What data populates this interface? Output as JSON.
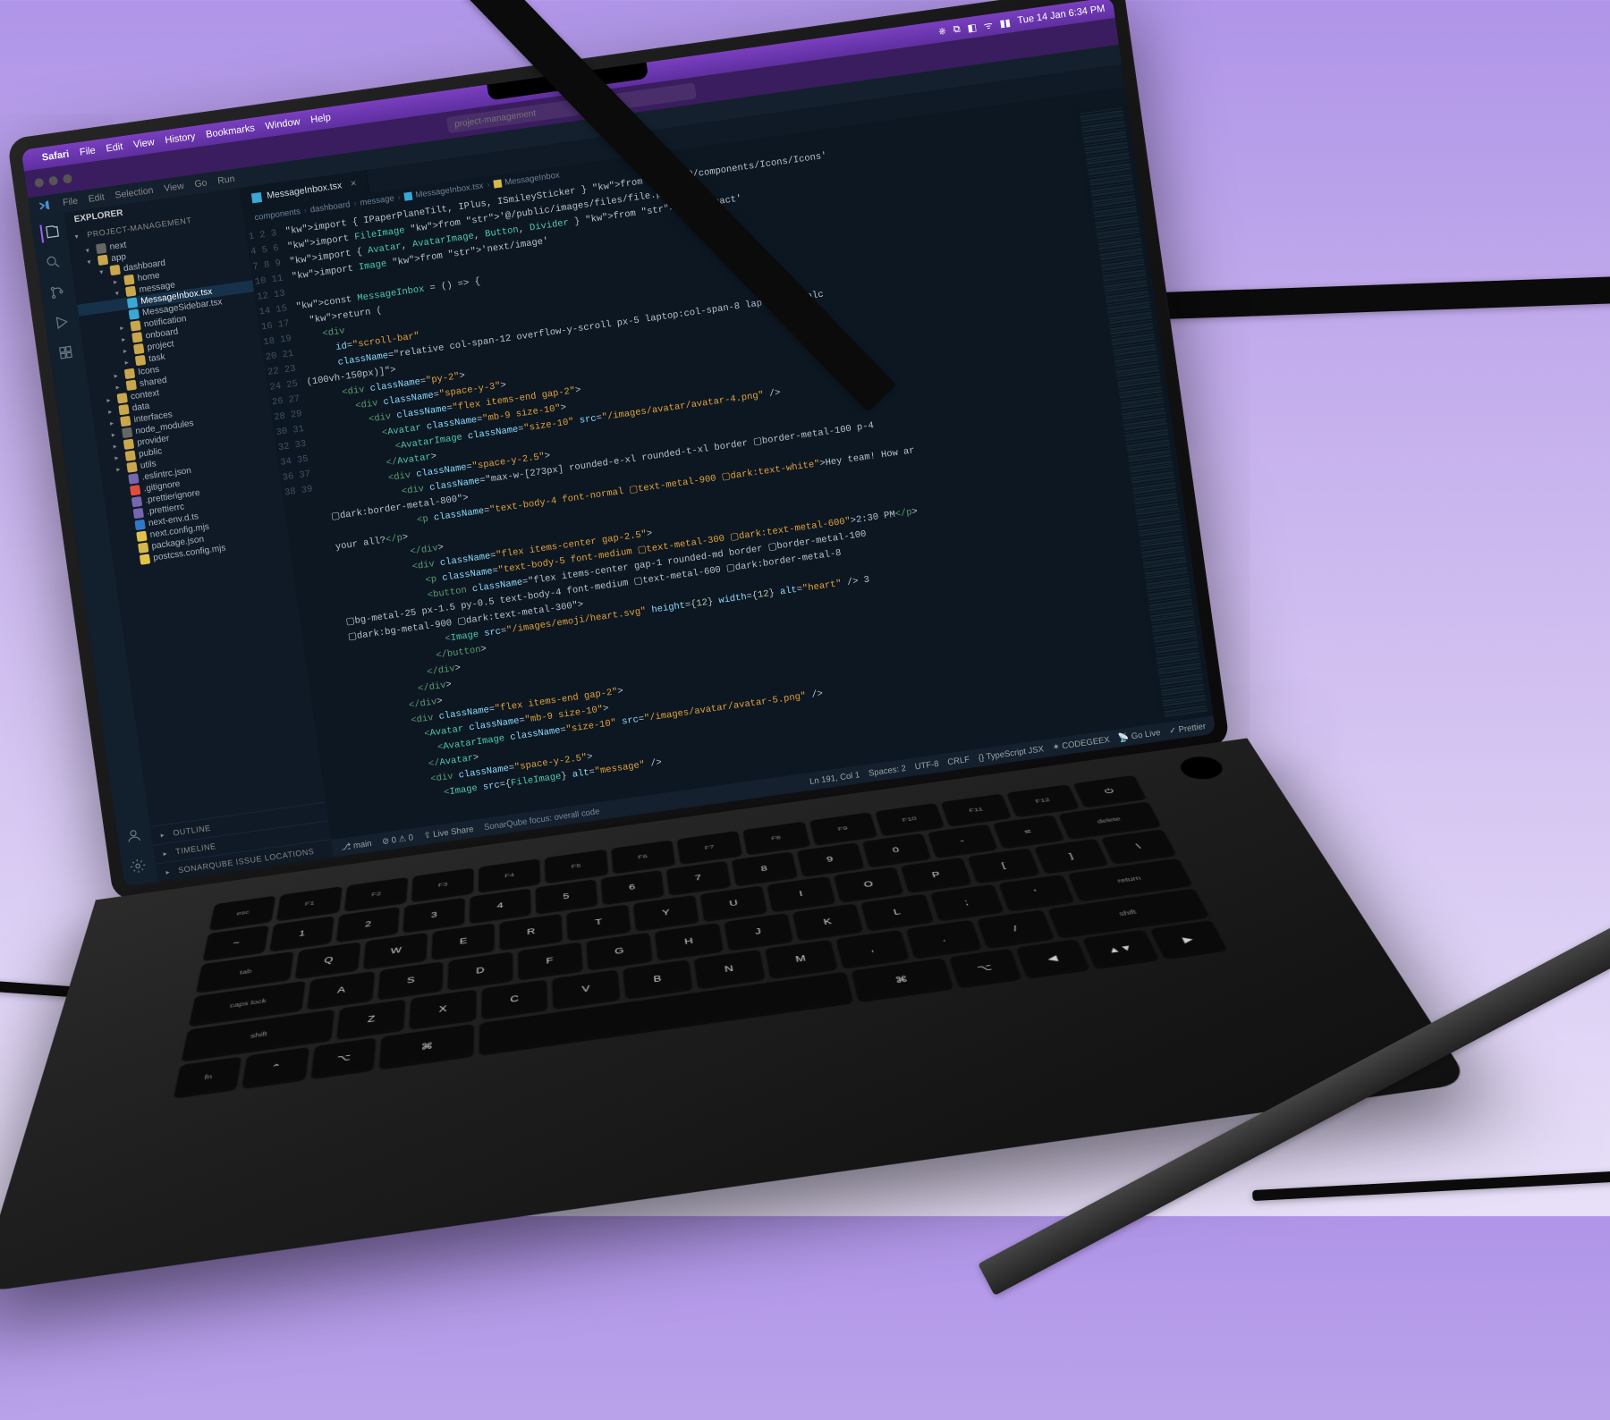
{
  "mac_menubar": {
    "app": "Safari",
    "items": [
      "File",
      "Edit",
      "View",
      "History",
      "Bookmarks",
      "Window",
      "Help"
    ],
    "datetime": "Tue 14 Jan  6:34 PM"
  },
  "vscode": {
    "title_search_placeholder": "project-management",
    "app_menu": [
      "File",
      "Edit",
      "Selection",
      "View",
      "Go",
      "Run"
    ],
    "explorer_label": "EXPLORER",
    "project_name": "PROJECT-MANAGEMENT",
    "outline_label": "OUTLINE",
    "timeline_label": "TIMELINE",
    "sonar_label": "SONARQUBE ISSUE LOCATIONS",
    "tab": {
      "name": "MessageInbox.tsx"
    },
    "breadcrumbs": [
      "components",
      "dashboard",
      "message",
      "MessageInbox.tsx",
      "MessageInbox"
    ],
    "statusbar": {
      "branch": "main",
      "errors": "0",
      "warnings": "0",
      "liveshare": "Live Share",
      "sonar_hint": "SonarQube focus: overall code",
      "cursor": "Ln 191, Col 1",
      "spaces": "Spaces: 2",
      "encoding": "UTF-8",
      "eol": "CRLF",
      "lang": "TypeScript JSX",
      "codegeex": "CODEGEEX",
      "golive": "Go Live",
      "prettier": "Prettier"
    }
  },
  "tree": [
    {
      "depth": 0,
      "kind": "folder",
      "open": true,
      "name": "next",
      "fi": "gray"
    },
    {
      "depth": 0,
      "kind": "folder",
      "open": true,
      "name": "app",
      "fi": "folder"
    },
    {
      "depth": 1,
      "kind": "folder",
      "open": true,
      "name": "dashboard",
      "fi": "folder"
    },
    {
      "depth": 2,
      "kind": "folder",
      "name": "home",
      "fi": "folder"
    },
    {
      "depth": 2,
      "kind": "folder",
      "open": true,
      "name": "message",
      "fi": "folder"
    },
    {
      "depth": 2,
      "kind": "file",
      "name": "MessageInbox.tsx",
      "fi": "react",
      "selected": true
    },
    {
      "depth": 2,
      "kind": "file",
      "name": "MessageSidebar.tsx",
      "fi": "react"
    },
    {
      "depth": 2,
      "kind": "folder",
      "name": "notification",
      "fi": "folder"
    },
    {
      "depth": 2,
      "kind": "folder",
      "name": "onboard",
      "fi": "folder"
    },
    {
      "depth": 2,
      "kind": "folder",
      "name": "project",
      "fi": "folder"
    },
    {
      "depth": 2,
      "kind": "folder",
      "name": "task",
      "fi": "folder"
    },
    {
      "depth": 1,
      "kind": "folder",
      "name": "Icons",
      "fi": "folder"
    },
    {
      "depth": 1,
      "kind": "folder",
      "name": "shared",
      "fi": "folder"
    },
    {
      "depth": 0,
      "kind": "folder",
      "name": "context",
      "fi": "folder"
    },
    {
      "depth": 0,
      "kind": "folder",
      "name": "data",
      "fi": "folder"
    },
    {
      "depth": 0,
      "kind": "folder",
      "name": "interfaces",
      "fi": "folder"
    },
    {
      "depth": 0,
      "kind": "folder",
      "name": "node_modules",
      "fi": "gray"
    },
    {
      "depth": 0,
      "kind": "folder",
      "name": "provider",
      "fi": "folder"
    },
    {
      "depth": 0,
      "kind": "folder",
      "name": "public",
      "fi": "folder"
    },
    {
      "depth": 0,
      "kind": "folder",
      "name": "utils",
      "fi": "folder"
    },
    {
      "depth": 0,
      "kind": "file",
      "name": ".eslintrc.json",
      "fi": "conf"
    },
    {
      "depth": 0,
      "kind": "file",
      "name": ".gitignore",
      "fi": "git"
    },
    {
      "depth": 0,
      "kind": "file",
      "name": ".prettierignore",
      "fi": "conf"
    },
    {
      "depth": 0,
      "kind": "file",
      "name": ".prettierrc",
      "fi": "conf"
    },
    {
      "depth": 0,
      "kind": "file",
      "name": "next-env.d.ts",
      "fi": "ts"
    },
    {
      "depth": 0,
      "kind": "file",
      "name": "next.config.mjs",
      "fi": "mjs"
    },
    {
      "depth": 0,
      "kind": "file",
      "name": "package.json",
      "fi": "json"
    },
    {
      "depth": 0,
      "kind": "file",
      "name": "postcss.config.mjs",
      "fi": "mjs"
    }
  ],
  "code_lines": [
    "import { IPaperPlaneTilt, IPlus, ISmileySticker } from '@/components/Icons/Icons'",
    "import FileImage from '@/public/images/files/file.png'",
    "import { Avatar, AvatarImage, Button, Divider } from 'keep-react'",
    "import Image from 'next/image'",
    "",
    "const MessageInbox = () => {",
    "  return (",
    "    <div",
    "      id=\"scroll-bar\"",
    "      className=\"relative col-span-12 overflow-y-scroll px-5 laptop:col-span-8 laptop:h-[calc",
    "(100vh-150px)]\">",
    "      <div className=\"py-2\">",
    "        <div className=\"space-y-3\">",
    "          <div className=\"flex items-end gap-2\">",
    "            <Avatar className=\"mb-9 size-10\">",
    "              <AvatarImage className=\"size-10\" src=\"/images/avatar/avatar-4.png\" />",
    "            </Avatar>",
    "            <div className=\"space-y-2.5\">",
    "              <div className=\"max-w-[273px] rounded-e-xl rounded-t-xl border ▢border-metal-100 p-4",
    " ▢dark:border-metal-800\">",
    "                <p className=\"text-body-4 font-normal ▢text-metal-900 ▢dark:text-white\">Hey team! How ar",
    " your all?</p>",
    "              </div>",
    "              <div className=\"flex items-center gap-2.5\">",
    "                <p className=\"text-body-5 font-medium ▢text-metal-300 ▢dark:text-metal-600\">2:30 PM</p>",
    "                <button className=\"flex items-center gap-1 rounded-md border ▢border-metal-100",
    " ▢bg-metal-25 px-1.5 py-0.5 text-body-4 font-medium ▢text-metal-600 ▢dark:border-metal-8",
    " ▢dark:bg-metal-900 ▢dark:text-metal-300\">",
    "                  <Image src=\"/images/emoji/heart.svg\" height={12} width={12} alt=\"heart\" /> 3",
    "                </button>",
    "              </div>",
    "            </div>",
    "          </div>",
    "          <div className=\"flex items-end gap-2\">",
    "            <Avatar className=\"mb-9 size-10\">",
    "              <AvatarImage className=\"size-10\" src=\"/images/avatar/avatar-5.png\" />",
    "            </Avatar>",
    "            <div className=\"space-y-2.5\">",
    "              <Image src={FileImage} alt=\"message\" />"
  ],
  "keyboard_rows": [
    [
      "esc",
      "F1",
      "F2",
      "F3",
      "F4",
      "F5",
      "F6",
      "F7",
      "F8",
      "F9",
      "F10",
      "F11",
      "F12",
      "⏻"
    ],
    [
      "~",
      "1",
      "2",
      "3",
      "4",
      "5",
      "6",
      "7",
      "8",
      "9",
      "0",
      "-",
      "=",
      "delete"
    ],
    [
      "tab",
      "Q",
      "W",
      "E",
      "R",
      "T",
      "Y",
      "U",
      "I",
      "O",
      "P",
      "[",
      "]",
      "\\"
    ],
    [
      "caps lock",
      "A",
      "S",
      "D",
      "F",
      "G",
      "H",
      "J",
      "K",
      "L",
      ";",
      "'",
      "return"
    ],
    [
      "shift",
      "Z",
      "X",
      "C",
      "V",
      "B",
      "N",
      "M",
      ",",
      ".",
      "/",
      "shift"
    ],
    [
      "fn",
      "⌃",
      "⌥",
      "⌘",
      " ",
      "⌘",
      "⌥",
      "◀",
      "▲▼",
      "▶"
    ]
  ]
}
